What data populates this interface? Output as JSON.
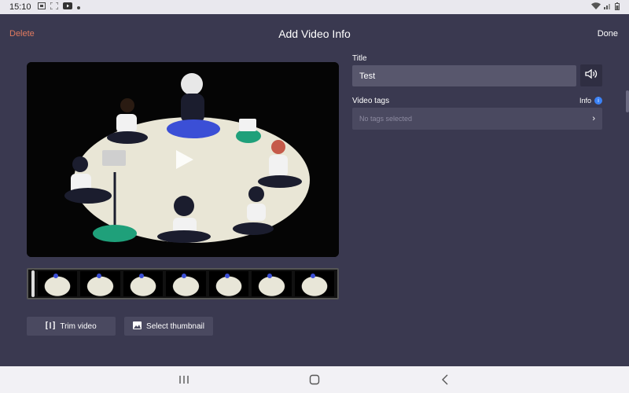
{
  "status_bar": {
    "time": "15:10",
    "left_icons": [
      "screenshot-icon",
      "scan-icon",
      "youtube-icon",
      "dot-icon"
    ],
    "right_icons": [
      "wifi-icon",
      "signal-icon",
      "battery-icon"
    ]
  },
  "app_bar": {
    "delete_label": "Delete",
    "title": "Add Video Info",
    "done_label": "Done"
  },
  "video": {
    "play_icon": "play-icon"
  },
  "actions": {
    "trim_label": "Trim video",
    "thumbnail_label": "Select thumbnail"
  },
  "form": {
    "title_label": "Title",
    "title_value": "Test",
    "tags_label": "Video tags",
    "tags_placeholder": "No tags selected",
    "info_label": "Info",
    "info_icon": "i"
  },
  "colors": {
    "background": "#3a3950",
    "accent_delete": "#e07a5f",
    "input_bg": "#58576d",
    "info_blue": "#3b82f6"
  }
}
